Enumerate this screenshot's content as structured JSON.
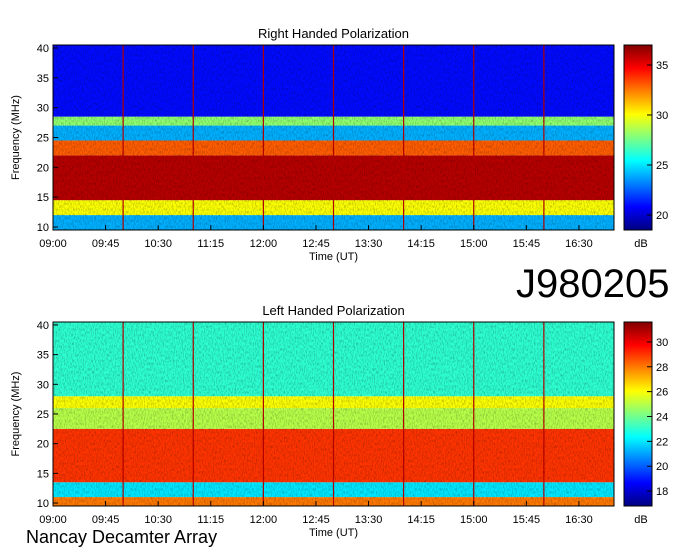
{
  "figure": {
    "observation_id": "J980205",
    "observatory": "Nancay Decamter Array",
    "colors": [
      "#000080",
      "#0000ff",
      "#0080ff",
      "#00ffff",
      "#80ff80",
      "#ffff00",
      "#ff8000",
      "#ff0000",
      "#800000"
    ]
  },
  "chart_data": [
    {
      "type": "heatmap",
      "title": "Right Handed Polarization",
      "xlabel": "Time (UT)",
      "ylabel": "Frequency (MHz)",
      "x_ticks": [
        "09:00",
        "09:45",
        "10:30",
        "11:15",
        "12:00",
        "12:45",
        "13:30",
        "14:15",
        "15:00",
        "15:45",
        "16:30"
      ],
      "x_range": [
        "09:00",
        "17:00"
      ],
      "y_ticks": [
        10,
        15,
        20,
        25,
        30,
        35,
        40
      ],
      "ylim": [
        9.5,
        40.5
      ],
      "colorbar": {
        "label": "dB",
        "ticks": [
          20,
          25,
          30,
          35
        ],
        "range": [
          18.5,
          37
        ]
      },
      "bands": [
        {
          "from": 9.5,
          "to": 12,
          "value": 24
        },
        {
          "from": 12,
          "to": 14.5,
          "value": 30
        },
        {
          "from": 14.5,
          "to": 22,
          "value": 36
        },
        {
          "from": 22,
          "to": 24.5,
          "value": 33
        },
        {
          "from": 24.5,
          "to": 27,
          "value": 24
        },
        {
          "from": 27,
          "to": 28.5,
          "value": 28
        },
        {
          "from": 28.5,
          "to": 40.5,
          "value": 21
        }
      ],
      "vertical_lines": [
        "10:00",
        "11:00",
        "12:00",
        "13:00",
        "14:00",
        "15:00",
        "16:00"
      ]
    },
    {
      "type": "heatmap",
      "title": "Left Handed Polarization",
      "xlabel": "Time (UT)",
      "ylabel": "Frequency (MHz)",
      "x_ticks": [
        "09:00",
        "09:45",
        "10:30",
        "11:15",
        "12:00",
        "12:45",
        "13:30",
        "14:15",
        "15:00",
        "15:45",
        "16:30"
      ],
      "x_range": [
        "09:00",
        "17:00"
      ],
      "y_ticks": [
        10,
        15,
        20,
        25,
        30,
        35,
        40
      ],
      "ylim": [
        9.5,
        40.5
      ],
      "colorbar": {
        "label": "dB",
        "ticks": [
          18,
          20,
          22,
          24,
          26,
          28,
          30
        ],
        "range": [
          16.8,
          31.6
        ]
      },
      "bands": [
        {
          "from": 9.5,
          "to": 11,
          "value": 28
        },
        {
          "from": 11,
          "to": 13.5,
          "value": 22
        },
        {
          "from": 13.5,
          "to": 22.5,
          "value": 29
        },
        {
          "from": 22.5,
          "to": 26,
          "value": 25
        },
        {
          "from": 26,
          "to": 28,
          "value": 26
        },
        {
          "from": 28,
          "to": 40.5,
          "value": 23
        }
      ],
      "vertical_lines": [
        "10:00",
        "11:00",
        "12:00",
        "13:00",
        "14:00",
        "15:00",
        "16:00"
      ]
    }
  ]
}
